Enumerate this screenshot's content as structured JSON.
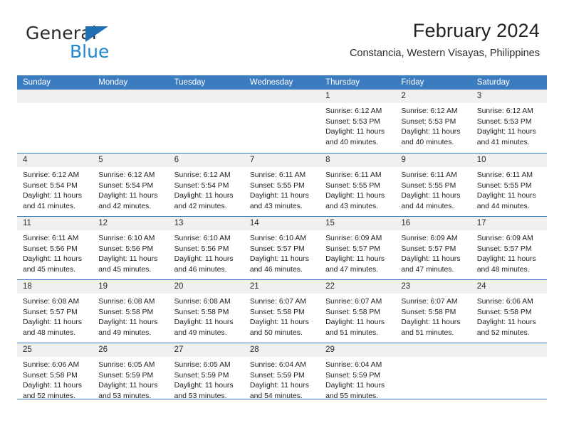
{
  "brand": {
    "name_part1": "General",
    "name_part2": "Blue",
    "triangle_color": "#1f6fb2",
    "blue_color": "#1f86d0"
  },
  "header": {
    "title": "February 2024",
    "subtitle": "Constancia, Western Visayas, Philippines"
  },
  "theme": {
    "header_bg": "#3b7bbf",
    "day_band_bg": "#f0f0f0",
    "rule_color": "#3b7bbf"
  },
  "weekdays": [
    "Sunday",
    "Monday",
    "Tuesday",
    "Wednesday",
    "Thursday",
    "Friday",
    "Saturday"
  ],
  "weeks": [
    [
      {
        "day": "",
        "sunrise": "",
        "sunset": "",
        "daylight1": "",
        "daylight2": ""
      },
      {
        "day": "",
        "sunrise": "",
        "sunset": "",
        "daylight1": "",
        "daylight2": ""
      },
      {
        "day": "",
        "sunrise": "",
        "sunset": "",
        "daylight1": "",
        "daylight2": ""
      },
      {
        "day": "",
        "sunrise": "",
        "sunset": "",
        "daylight1": "",
        "daylight2": ""
      },
      {
        "day": "1",
        "sunrise": "Sunrise: 6:12 AM",
        "sunset": "Sunset: 5:53 PM",
        "daylight1": "Daylight: 11 hours",
        "daylight2": "and 40 minutes."
      },
      {
        "day": "2",
        "sunrise": "Sunrise: 6:12 AM",
        "sunset": "Sunset: 5:53 PM",
        "daylight1": "Daylight: 11 hours",
        "daylight2": "and 40 minutes."
      },
      {
        "day": "3",
        "sunrise": "Sunrise: 6:12 AM",
        "sunset": "Sunset: 5:53 PM",
        "daylight1": "Daylight: 11 hours",
        "daylight2": "and 41 minutes."
      }
    ],
    [
      {
        "day": "4",
        "sunrise": "Sunrise: 6:12 AM",
        "sunset": "Sunset: 5:54 PM",
        "daylight1": "Daylight: 11 hours",
        "daylight2": "and 41 minutes."
      },
      {
        "day": "5",
        "sunrise": "Sunrise: 6:12 AM",
        "sunset": "Sunset: 5:54 PM",
        "daylight1": "Daylight: 11 hours",
        "daylight2": "and 42 minutes."
      },
      {
        "day": "6",
        "sunrise": "Sunrise: 6:12 AM",
        "sunset": "Sunset: 5:54 PM",
        "daylight1": "Daylight: 11 hours",
        "daylight2": "and 42 minutes."
      },
      {
        "day": "7",
        "sunrise": "Sunrise: 6:11 AM",
        "sunset": "Sunset: 5:55 PM",
        "daylight1": "Daylight: 11 hours",
        "daylight2": "and 43 minutes."
      },
      {
        "day": "8",
        "sunrise": "Sunrise: 6:11 AM",
        "sunset": "Sunset: 5:55 PM",
        "daylight1": "Daylight: 11 hours",
        "daylight2": "and 43 minutes."
      },
      {
        "day": "9",
        "sunrise": "Sunrise: 6:11 AM",
        "sunset": "Sunset: 5:55 PM",
        "daylight1": "Daylight: 11 hours",
        "daylight2": "and 44 minutes."
      },
      {
        "day": "10",
        "sunrise": "Sunrise: 6:11 AM",
        "sunset": "Sunset: 5:55 PM",
        "daylight1": "Daylight: 11 hours",
        "daylight2": "and 44 minutes."
      }
    ],
    [
      {
        "day": "11",
        "sunrise": "Sunrise: 6:11 AM",
        "sunset": "Sunset: 5:56 PM",
        "daylight1": "Daylight: 11 hours",
        "daylight2": "and 45 minutes."
      },
      {
        "day": "12",
        "sunrise": "Sunrise: 6:10 AM",
        "sunset": "Sunset: 5:56 PM",
        "daylight1": "Daylight: 11 hours",
        "daylight2": "and 45 minutes."
      },
      {
        "day": "13",
        "sunrise": "Sunrise: 6:10 AM",
        "sunset": "Sunset: 5:56 PM",
        "daylight1": "Daylight: 11 hours",
        "daylight2": "and 46 minutes."
      },
      {
        "day": "14",
        "sunrise": "Sunrise: 6:10 AM",
        "sunset": "Sunset: 5:57 PM",
        "daylight1": "Daylight: 11 hours",
        "daylight2": "and 46 minutes."
      },
      {
        "day": "15",
        "sunrise": "Sunrise: 6:09 AM",
        "sunset": "Sunset: 5:57 PM",
        "daylight1": "Daylight: 11 hours",
        "daylight2": "and 47 minutes."
      },
      {
        "day": "16",
        "sunrise": "Sunrise: 6:09 AM",
        "sunset": "Sunset: 5:57 PM",
        "daylight1": "Daylight: 11 hours",
        "daylight2": "and 47 minutes."
      },
      {
        "day": "17",
        "sunrise": "Sunrise: 6:09 AM",
        "sunset": "Sunset: 5:57 PM",
        "daylight1": "Daylight: 11 hours",
        "daylight2": "and 48 minutes."
      }
    ],
    [
      {
        "day": "18",
        "sunrise": "Sunrise: 6:08 AM",
        "sunset": "Sunset: 5:57 PM",
        "daylight1": "Daylight: 11 hours",
        "daylight2": "and 48 minutes."
      },
      {
        "day": "19",
        "sunrise": "Sunrise: 6:08 AM",
        "sunset": "Sunset: 5:58 PM",
        "daylight1": "Daylight: 11 hours",
        "daylight2": "and 49 minutes."
      },
      {
        "day": "20",
        "sunrise": "Sunrise: 6:08 AM",
        "sunset": "Sunset: 5:58 PM",
        "daylight1": "Daylight: 11 hours",
        "daylight2": "and 49 minutes."
      },
      {
        "day": "21",
        "sunrise": "Sunrise: 6:07 AM",
        "sunset": "Sunset: 5:58 PM",
        "daylight1": "Daylight: 11 hours",
        "daylight2": "and 50 minutes."
      },
      {
        "day": "22",
        "sunrise": "Sunrise: 6:07 AM",
        "sunset": "Sunset: 5:58 PM",
        "daylight1": "Daylight: 11 hours",
        "daylight2": "and 51 minutes."
      },
      {
        "day": "23",
        "sunrise": "Sunrise: 6:07 AM",
        "sunset": "Sunset: 5:58 PM",
        "daylight1": "Daylight: 11 hours",
        "daylight2": "and 51 minutes."
      },
      {
        "day": "24",
        "sunrise": "Sunrise: 6:06 AM",
        "sunset": "Sunset: 5:58 PM",
        "daylight1": "Daylight: 11 hours",
        "daylight2": "and 52 minutes."
      }
    ],
    [
      {
        "day": "25",
        "sunrise": "Sunrise: 6:06 AM",
        "sunset": "Sunset: 5:58 PM",
        "daylight1": "Daylight: 11 hours",
        "daylight2": "and 52 minutes."
      },
      {
        "day": "26",
        "sunrise": "Sunrise: 6:05 AM",
        "sunset": "Sunset: 5:59 PM",
        "daylight1": "Daylight: 11 hours",
        "daylight2": "and 53 minutes."
      },
      {
        "day": "27",
        "sunrise": "Sunrise: 6:05 AM",
        "sunset": "Sunset: 5:59 PM",
        "daylight1": "Daylight: 11 hours",
        "daylight2": "and 53 minutes."
      },
      {
        "day": "28",
        "sunrise": "Sunrise: 6:04 AM",
        "sunset": "Sunset: 5:59 PM",
        "daylight1": "Daylight: 11 hours",
        "daylight2": "and 54 minutes."
      },
      {
        "day": "29",
        "sunrise": "Sunrise: 6:04 AM",
        "sunset": "Sunset: 5:59 PM",
        "daylight1": "Daylight: 11 hours",
        "daylight2": "and 55 minutes."
      },
      {
        "day": "",
        "sunrise": "",
        "sunset": "",
        "daylight1": "",
        "daylight2": ""
      },
      {
        "day": "",
        "sunrise": "",
        "sunset": "",
        "daylight1": "",
        "daylight2": ""
      }
    ]
  ]
}
